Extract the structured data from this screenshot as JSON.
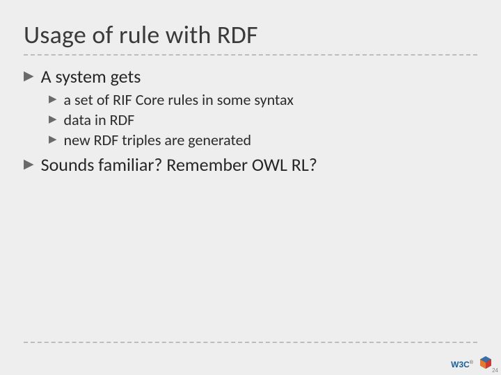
{
  "title": "Usage of rule with RDF",
  "bullets": [
    {
      "level": 1,
      "text": "A system gets",
      "children": [
        {
          "text": "a set of RIF Core rules in some syntax"
        },
        {
          "text": "data in RDF"
        },
        {
          "text": "new RDF triples are generated"
        }
      ]
    },
    {
      "level": 1,
      "text": "Sounds familiar? Remember OWL RL?",
      "children": []
    }
  ],
  "footer": {
    "w3c": "W3C",
    "page": "24"
  }
}
